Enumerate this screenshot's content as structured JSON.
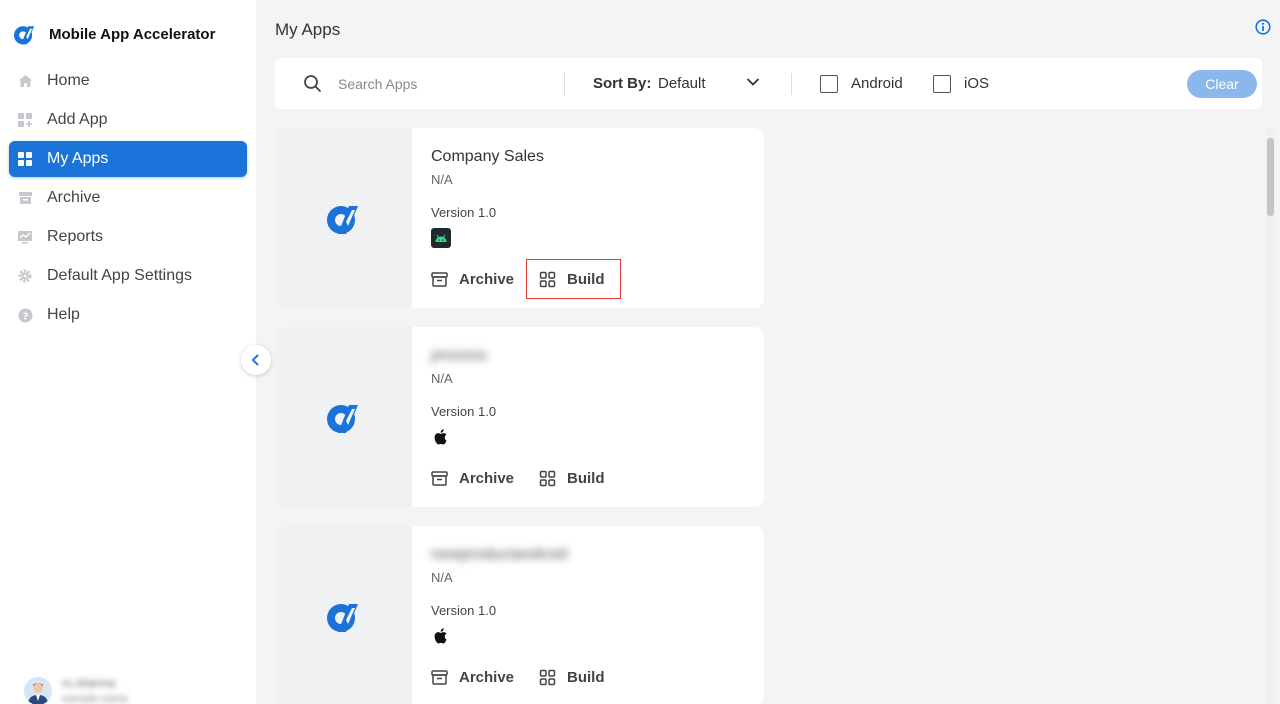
{
  "app": {
    "name": "Mobile App Accelerator"
  },
  "sidebar": {
    "items": [
      {
        "label": "Home",
        "icon": "home-icon"
      },
      {
        "label": "Add App",
        "icon": "add-app-icon"
      },
      {
        "label": "My Apps",
        "icon": "grid-icon",
        "active": true
      },
      {
        "label": "Archive",
        "icon": "archive-icon"
      },
      {
        "label": "Reports",
        "icon": "reports-icon"
      },
      {
        "label": "Default App Settings",
        "icon": "gear-icon"
      },
      {
        "label": "Help",
        "icon": "help-icon"
      }
    ],
    "user": {
      "name": "rs.sharma",
      "sub": "sample.name"
    }
  },
  "page": {
    "title": "My Apps"
  },
  "filters": {
    "search_placeholder": "Search Apps",
    "sort_label": "Sort By:",
    "sort_value": "Default",
    "android_label": "Android",
    "ios_label": "iOS",
    "clear_label": "Clear"
  },
  "apps": [
    {
      "name": "Company Sales",
      "sub": "N/A",
      "version": "Version 1.0",
      "platform": "android",
      "archive_label": "Archive",
      "build_label": "Build",
      "name_blurred": false
    },
    {
      "name": "process",
      "sub": "N/A",
      "version": "Version 1.0",
      "platform": "ios",
      "archive_label": "Archive",
      "build_label": "Build",
      "name_blurred": true
    },
    {
      "name": "newproductandroid",
      "sub": "N/A",
      "version": "Version 1.0",
      "platform": "ios",
      "archive_label": "Archive",
      "build_label": "Build",
      "name_blurred": true
    }
  ],
  "colors": {
    "accent": "#1a73d9",
    "highlight": "#e53935",
    "clear_button": "#8ab8ea"
  }
}
